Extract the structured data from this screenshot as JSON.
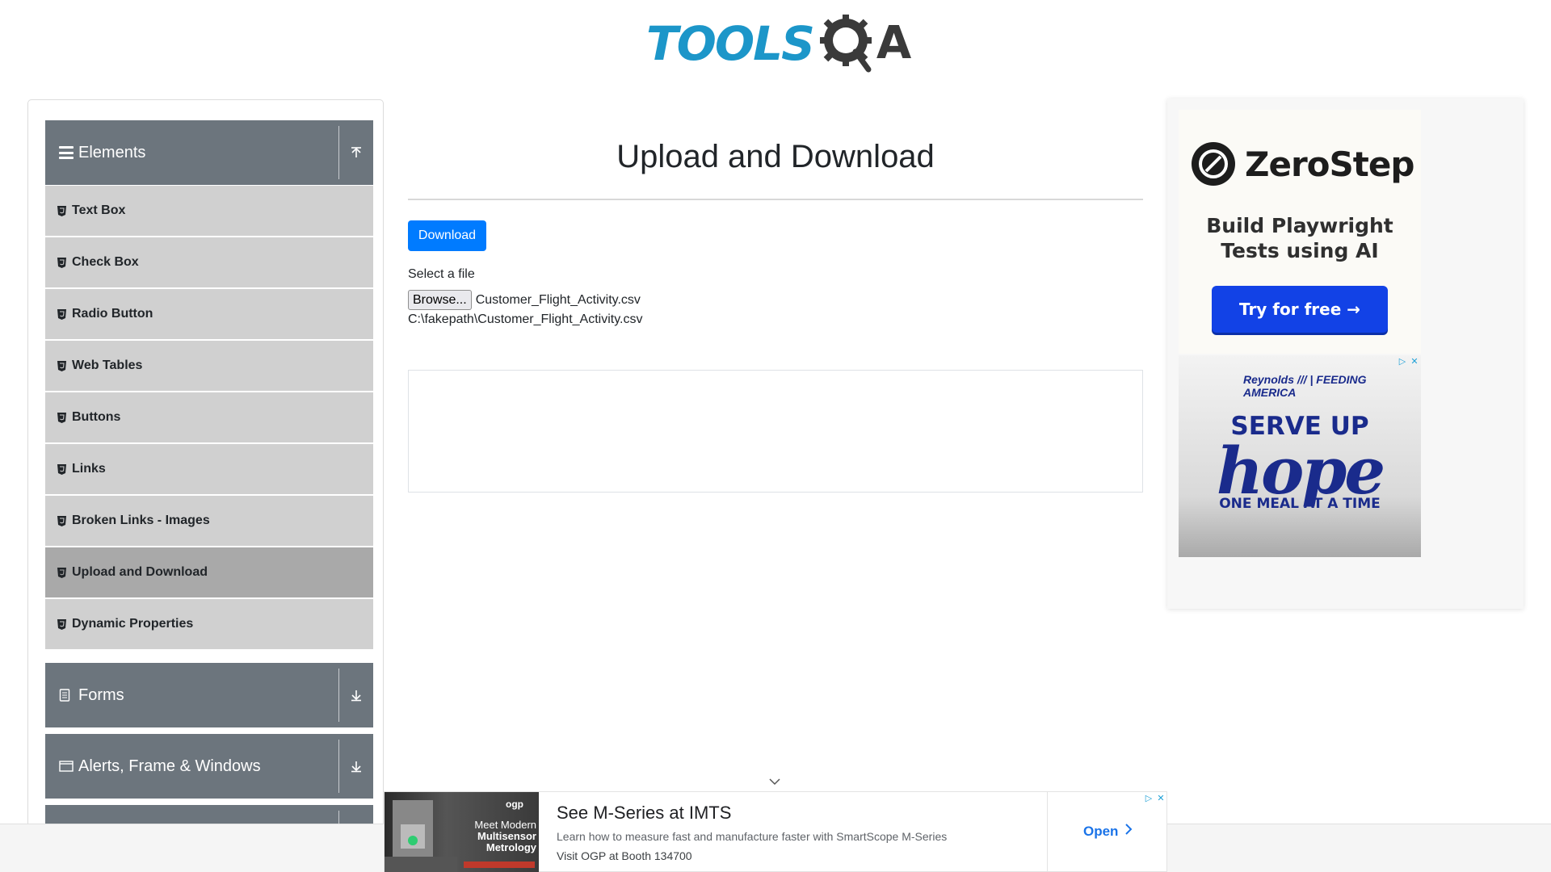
{
  "logo": {
    "text": "TOOLS",
    "suffix": "A"
  },
  "sidebar": {
    "elements_header": "Elements",
    "items": [
      {
        "label": "Text Box"
      },
      {
        "label": "Check Box"
      },
      {
        "label": "Radio Button"
      },
      {
        "label": "Web Tables"
      },
      {
        "label": "Buttons"
      },
      {
        "label": "Links"
      },
      {
        "label": "Broken Links - Images"
      },
      {
        "label": "Upload and Download",
        "active": true
      },
      {
        "label": "Dynamic Properties"
      }
    ],
    "forms_header": "Forms",
    "alerts_header": "Alerts, Frame & Windows"
  },
  "main": {
    "title": "Upload and Download",
    "download_label": "Download",
    "select_label": "Select a file",
    "browse_label": "Browse...",
    "file_name": "Customer_Flight_Activity.csv",
    "uploaded_path": "C:\\fakepath\\Customer_Flight_Activity.csv"
  },
  "ad_right": {
    "brand": "ZeroStep",
    "tagline_1": "Build Playwright",
    "tagline_2": "Tests using AI",
    "cta": "Try for free →",
    "feed_brand": "Reynolds /// | FEEDING AMERICA",
    "feed_line1": "SERVE UP",
    "feed_line2": "hope",
    "feed_line3": "ONE MEAL  AT A TIME"
  },
  "ad_bottom": {
    "img_brand": "ogp",
    "img_line1": "Meet Modern",
    "img_line2": "Multisensor",
    "img_line3": "Metrology",
    "headline": "See M-Series at IMTS",
    "description": "Learn how to measure fast and manufacture faster with SmartScope M-Series",
    "visit": "Visit OGP at Booth 134700",
    "open_label": "Open"
  },
  "colors": {
    "primary": "#007bff",
    "sidebar_header": "#6c757d",
    "menu_item": "#d0d0d0",
    "menu_item_active": "#a9a9a9",
    "logo_blue": "#1c96c9"
  }
}
